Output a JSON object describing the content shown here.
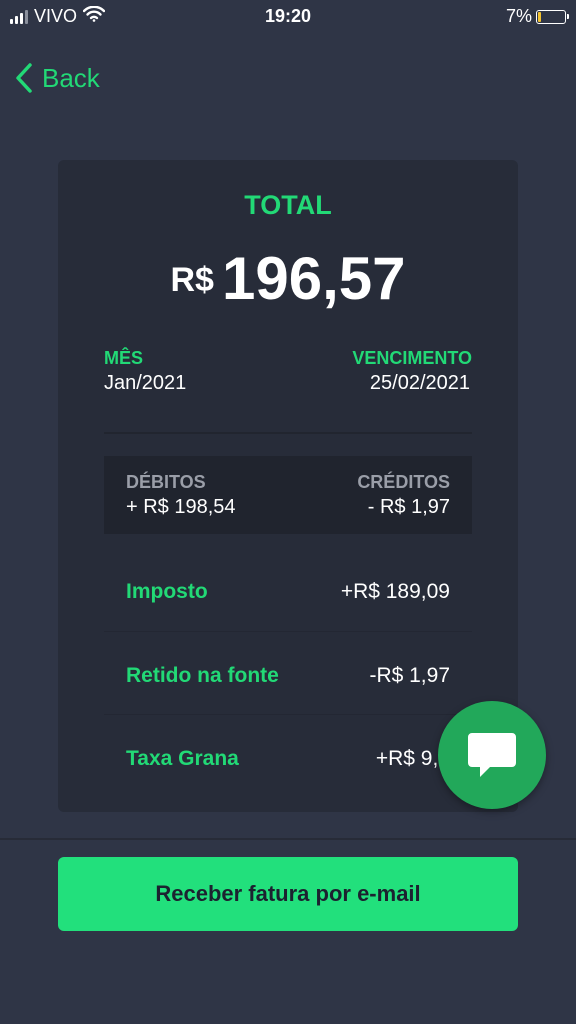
{
  "status_bar": {
    "carrier": "VIVO",
    "time": "19:20",
    "battery_percent": "7%"
  },
  "nav": {
    "back_label": "Back"
  },
  "invoice": {
    "total_label": "TOTAL",
    "currency": "R$",
    "total_value": "196,57",
    "month_label": "MÊS",
    "month_value": "Jan/2021",
    "due_label": "VENCIMENTO",
    "due_value": "25/02/2021",
    "debits_label": "DÉBITOS",
    "debits_value": "+ R$ 198,54",
    "credits_label": "CRÉDITOS",
    "credits_value": "- R$ 1,97",
    "items": [
      {
        "label": "Imposto",
        "value": "+R$ 189,09"
      },
      {
        "label": "Retido na fonte",
        "value": "-R$ 1,97"
      },
      {
        "label": "Taxa Grana",
        "value": "+R$ 9,4"
      }
    ]
  },
  "actions": {
    "email_button_label": "Receber fatura por e-mail"
  },
  "colors": {
    "background": "#2f3546",
    "card": "#272c39",
    "accent": "#22d976",
    "button": "#22e07c",
    "chat_fab": "#22a85a",
    "battery_low": "#f4c430"
  },
  "icons": [
    "signal-icon",
    "wifi-icon",
    "battery-icon",
    "back-chevron-icon",
    "chat-icon"
  ]
}
